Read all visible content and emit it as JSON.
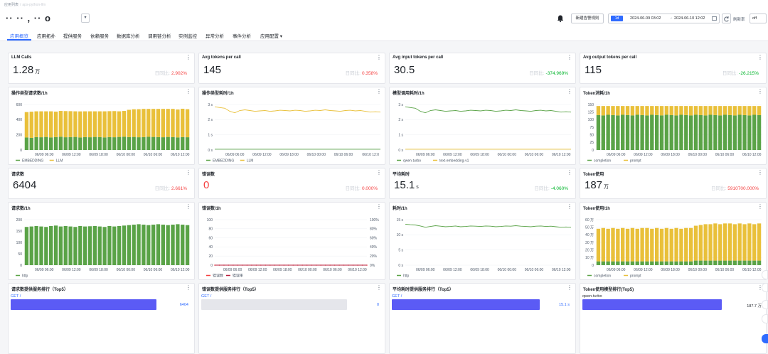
{
  "breadcrumb": {
    "root": "应用列表",
    "sep": "/",
    "current": "aps-python-llm"
  },
  "header": {
    "app_name": "·· ·· , ·· o",
    "new_alert_button": "新建告警规则",
    "time_chip": "1d",
    "time_start": "2024-06-09 03:02",
    "time_arrow": "→",
    "time_end": "2024-06-10 12:02",
    "refresh_label": "刷新率",
    "refresh_value": "off"
  },
  "tabs": [
    {
      "label": "应用概览",
      "active": true
    },
    {
      "label": "应用拓扑"
    },
    {
      "label": "提供服务"
    },
    {
      "label": "依赖服务"
    },
    {
      "label": "数据库分析"
    },
    {
      "label": "调用链分析"
    },
    {
      "label": "实例监控"
    },
    {
      "label": "异常分析"
    },
    {
      "label": "事件分析"
    },
    {
      "label": "应用配置 ▾"
    }
  ],
  "kpis": [
    {
      "title": "LLM Calls",
      "value": "1.28",
      "unit": "万",
      "cmp_label": "日同比:",
      "cmp_value": "2.902%",
      "tone": "red"
    },
    {
      "title": "Avg tokens per call",
      "value": "145",
      "unit": "",
      "cmp_label": "日同比:",
      "cmp_value": "0.358%",
      "tone": "red"
    },
    {
      "title": "Avg input tokens per call",
      "value": "30.5",
      "unit": "",
      "cmp_label": "日同比:",
      "cmp_value": "-374.969%",
      "tone": "green"
    },
    {
      "title": "Avg output tokens per call",
      "value": "115",
      "unit": "",
      "cmp_label": "日同比:",
      "cmp_value": "-26.215%",
      "tone": "green"
    },
    {
      "title": "请求数",
      "value": "6404",
      "unit": "",
      "cmp_label": "日同比:",
      "cmp_value": "2.661%",
      "tone": "red"
    },
    {
      "title": "错误数",
      "value": "0",
      "unit": "",
      "cmp_label": "日同比:",
      "cmp_value": "0.000%",
      "tone": "red",
      "value_red": true
    },
    {
      "title": "平均耗时",
      "value": "15.1",
      "unit": "s",
      "cmp_label": "日同比:",
      "cmp_value": "-4.060%",
      "tone": "green"
    },
    {
      "title": "Token使用",
      "value": "187",
      "unit": "万",
      "cmp_label": "日同比:",
      "cmp_value": "5910700.000%",
      "tone": "red"
    }
  ],
  "chart_titles": [
    "操作类型请求数/1h",
    "操作类型耗时/1h",
    "模型调用耗时/1h",
    "Token消耗/1h",
    "请求数/1h",
    "错误数/1h",
    "耗时/1h",
    "Token使用/1h"
  ],
  "menu_icon": "⋮",
  "chart_data": [
    {
      "type": "bar",
      "title": "操作类型请求数/1h",
      "x_ticks": [
        "06/09 06:00",
        "06/09 12:00",
        "06/09 18:00",
        "06/10 00:00",
        "06/10 06:00",
        "06/10 12:00"
      ],
      "y_ticks": [
        "0",
        "200",
        "400",
        "600"
      ],
      "ylim": [
        0,
        600
      ],
      "stacked": true,
      "categories_count": 34,
      "series": [
        {
          "name": "EMBEDDING",
          "color": "#5aa347",
          "values": [
            165,
            160,
            170,
            168,
            172,
            166,
            170,
            175,
            168,
            170,
            172,
            165,
            170,
            168,
            172,
            170,
            166,
            170,
            168,
            172,
            175,
            170,
            172,
            168,
            170,
            174,
            172,
            170,
            168,
            172,
            170,
            166,
            170,
            168
          ]
        },
        {
          "name": "LLM",
          "color": "#e9c03a",
          "values": [
            335,
            345,
            340,
            342,
            338,
            344,
            336,
            340,
            345,
            342,
            338,
            344,
            340,
            342,
            338,
            340,
            344,
            342,
            345,
            338,
            340,
            360,
            365,
            370,
            372,
            368,
            370,
            372,
            374,
            370,
            372,
            368,
            374,
            370
          ]
        }
      ],
      "legend": "bottom-left"
    },
    {
      "type": "line",
      "title": "操作类型耗时/1h",
      "x_ticks": [
        "06/09 06:00",
        "06/09 12:00",
        "06/09 18:00",
        "06/10 00:00",
        "06/10 06:00",
        "06/10 12:0"
      ],
      "y_ticks": [
        "0 s",
        "1 s",
        "2 s",
        "3 s"
      ],
      "ylim": [
        0,
        3
      ],
      "series": [
        {
          "name": "EMBEDDING",
          "color": "#5aa347",
          "values": [
            0.05,
            0.05,
            0.05,
            0.05,
            0.05,
            0.05,
            0.05,
            0.05,
            0.05,
            0.05,
            0.05,
            0.05,
            0.05,
            0.05,
            0.05,
            0.05,
            0.05,
            0.05,
            0.05,
            0.05,
            0.05,
            0.05,
            0.05,
            0.05,
            0.05,
            0.05,
            0.05,
            0.05,
            0.05,
            0.05,
            0.05,
            0.05,
            0.05,
            0.05
          ]
        },
        {
          "name": "LLM",
          "color": "#e9c03a",
          "values": [
            2.85,
            2.8,
            2.75,
            2.55,
            2.45,
            2.6,
            2.65,
            2.6,
            2.55,
            2.58,
            2.6,
            2.55,
            2.58,
            2.62,
            2.6,
            2.58,
            2.62,
            2.6,
            2.55,
            2.58,
            2.62,
            2.6,
            2.65,
            2.6,
            2.58,
            2.55,
            2.6,
            2.62,
            2.58,
            2.6,
            2.55,
            2.5,
            2.52,
            2.5
          ]
        }
      ],
      "legend": "bottom-left"
    },
    {
      "type": "line",
      "title": "模型调用耗时/1h",
      "x_ticks": [
        "06/09 06:00",
        "06/09 12:00",
        "06/09 18:00",
        "06/10 00:00",
        "06/10 06:00",
        "06/10 12:00"
      ],
      "y_ticks": [
        "0 s",
        "1 s",
        "2 s",
        "3 s"
      ],
      "ylim": [
        0,
        3
      ],
      "series": [
        {
          "name": "qwen-turbo",
          "color": "#5aa347",
          "values": [
            2.85,
            2.8,
            2.75,
            2.55,
            2.45,
            2.6,
            2.65,
            2.6,
            2.55,
            2.58,
            2.6,
            2.55,
            2.58,
            2.62,
            2.6,
            2.58,
            2.62,
            2.6,
            2.55,
            2.58,
            2.62,
            2.6,
            2.65,
            2.6,
            2.58,
            2.55,
            2.6,
            2.62,
            2.58,
            2.6,
            2.55,
            2.5,
            2.52,
            2.5
          ]
        },
        {
          "name": "text-embedding-v1",
          "color": "#e9c03a",
          "values": [
            0.05,
            0.05,
            0.05,
            0.05,
            0.05,
            0.05,
            0.05,
            0.05,
            0.05,
            0.05,
            0.05,
            0.05,
            0.05,
            0.05,
            0.05,
            0.05,
            0.05,
            0.05,
            0.05,
            0.05,
            0.05,
            0.05,
            0.05,
            0.05,
            0.05,
            0.05,
            0.05,
            0.05,
            0.05,
            0.05,
            0.05,
            0.05,
            0.05,
            0.05
          ]
        }
      ],
      "legend": "bottom-left"
    },
    {
      "type": "bar",
      "title": "Token消耗/1h",
      "x_ticks": [
        "06/09 06:00",
        "06/09 12:00",
        "06/09 18:00",
        "06/10 00:00",
        "06/10 06:00",
        "06/10 12:00"
      ],
      "y_ticks": [
        "0",
        "25",
        "50",
        "75",
        "100",
        "125",
        "150"
      ],
      "ylim": [
        0,
        150
      ],
      "stacked": true,
      "categories_count": 34,
      "series": [
        {
          "name": "completion",
          "color": "#5aa347",
          "values": [
            115,
            114,
            116,
            115,
            114,
            116,
            115,
            114,
            116,
            115,
            114,
            116,
            115,
            114,
            116,
            115,
            114,
            116,
            115,
            114,
            116,
            115,
            114,
            116,
            115,
            114,
            116,
            115,
            114,
            116,
            115,
            114,
            116,
            115
          ]
        },
        {
          "name": "prompt",
          "color": "#e9c03a",
          "values": [
            30,
            31,
            29,
            30,
            31,
            29,
            30,
            31,
            29,
            30,
            31,
            29,
            30,
            31,
            29,
            30,
            31,
            29,
            30,
            31,
            29,
            30,
            31,
            29,
            30,
            31,
            29,
            30,
            31,
            29,
            30,
            31,
            29,
            30
          ]
        }
      ],
      "legend": "bottom-left"
    },
    {
      "type": "bar",
      "title": "请求数/1h",
      "x_ticks": [
        "06/09 06:00",
        "06/09 12:00",
        "06/09 18:00",
        "06/10 00:00",
        "06/10 06:00",
        "06/10 12:00"
      ],
      "y_ticks": [
        "0",
        "50",
        "100",
        "150",
        "200"
      ],
      "ylim": [
        0,
        200
      ],
      "categories_count": 34,
      "series": [
        {
          "name": "http",
          "color": "#5aa347",
          "values": [
            168,
            170,
            172,
            170,
            168,
            172,
            174,
            170,
            172,
            170,
            168,
            172,
            170,
            171,
            172,
            170,
            168,
            172,
            170,
            172,
            174,
            176,
            178,
            180,
            178,
            176,
            178,
            180,
            178,
            176,
            178,
            180,
            178,
            176
          ]
        }
      ],
      "legend": "bottom-left"
    },
    {
      "type": "line",
      "title": "错误数/1h",
      "x_ticks": [
        "06/09 06:00",
        "06/09 12:00",
        "06/09 18:00",
        "06/10 00:00",
        "06/10 06:00",
        "06/10 12:00"
      ],
      "y_ticks": [
        "0",
        "20",
        "40",
        "60",
        "80",
        "100"
      ],
      "y2_ticks": [
        "0%",
        "20%",
        "40%",
        "60%",
        "80%",
        "100%"
      ],
      "ylim": [
        0,
        100
      ],
      "series": [
        {
          "name": "错误数",
          "color": "#f53f3f",
          "dashed": true,
          "values": [
            0,
            0,
            0,
            0,
            0,
            0,
            0,
            0,
            0,
            0,
            0,
            0,
            0,
            0,
            0,
            0,
            0,
            0,
            0,
            0,
            0,
            0,
            0,
            0,
            0,
            0,
            0,
            0,
            0,
            0,
            0,
            0,
            0,
            0
          ]
        },
        {
          "name": "错误率",
          "color": "#b71c3a",
          "values": [
            0,
            0,
            0,
            0,
            0,
            0,
            0,
            0,
            0,
            0,
            0,
            0,
            0,
            0,
            0,
            0,
            0,
            0,
            0,
            0,
            0,
            0,
            0,
            0,
            0,
            0,
            0,
            0,
            0,
            0,
            0,
            0,
            0,
            0
          ]
        }
      ],
      "legend": "bottom-left"
    },
    {
      "type": "line",
      "title": "耗时/1h",
      "x_ticks": [
        "06/09 06:00",
        "06/09 12:00",
        "06/09 18:00",
        "06/10 00:00",
        "06/10 06:00",
        "06/10 12:00"
      ],
      "y_ticks": [
        "0 s",
        "5 s",
        "10 s",
        "15 s"
      ],
      "ylim": [
        0,
        18
      ],
      "series": [
        {
          "name": "http",
          "color": "#5aa347",
          "values": [
            16.2,
            16.0,
            15.9,
            15.5,
            15.0,
            15.3,
            15.6,
            15.4,
            15.2,
            15.3,
            15.5,
            15.2,
            15.3,
            15.5,
            15.4,
            15.3,
            15.5,
            15.4,
            15.2,
            15.3,
            15.5,
            15.4,
            15.6,
            15.4,
            15.3,
            15.2,
            15.4,
            15.5,
            15.3,
            15.4,
            15.2,
            15.0,
            15.1,
            15.0
          ]
        }
      ],
      "legend": "bottom-left"
    },
    {
      "type": "bar",
      "title": "Token使用/1h",
      "x_ticks": [
        "06/09 06:00",
        "06/09 12:00",
        "06/09 18:00",
        "06/10 00:00",
        "06/10 06:00",
        "06/10 12:00"
      ],
      "y_ticks": [
        "0",
        "10 万",
        "20 万",
        "30 万",
        "40 万",
        "50 万",
        "60 万"
      ],
      "ylim": [
        0,
        60
      ],
      "stacked": true,
      "categories_count": 34,
      "series": [
        {
          "name": "completion",
          "color": "#5aa347",
          "values": [
            5,
            5,
            5,
            5,
            5,
            5,
            5,
            5,
            5,
            5,
            5,
            5,
            5,
            5,
            5,
            5,
            5,
            5,
            5,
            5,
            6,
            6,
            6,
            6,
            6,
            6,
            6,
            6,
            6,
            6,
            6,
            6,
            6,
            6
          ]
        },
        {
          "name": "prompt",
          "color": "#e9c03a",
          "values": [
            43,
            44,
            43,
            44,
            43,
            44,
            43,
            44,
            43,
            44,
            44,
            43,
            44,
            43,
            44,
            43,
            44,
            43,
            44,
            44,
            46,
            47,
            48,
            48,
            49,
            48,
            49,
            49,
            48,
            49,
            48,
            49,
            48,
            49
          ]
        }
      ],
      "legend": "bottom-left"
    }
  ],
  "rankings": [
    {
      "title": "请求数提供服务排行（Top5）",
      "label": "GET /",
      "value": "6404",
      "fraction": 1.0,
      "fill": "#5b5bf5"
    },
    {
      "title": "错误数提供服务排行（Top5）",
      "label": "GET /",
      "value": "0",
      "fraction": 0.0,
      "fill": "#e5e6eb"
    },
    {
      "title": "平均耗时提供服务排行（Top5）",
      "label": "GET /",
      "value": "15.1 s",
      "fraction": 1.0,
      "fill": "#5b5bf5"
    },
    {
      "title": "Token使用模型排行(Top5)",
      "label": "qwen-turbo",
      "value": "187.7 万",
      "fraction": 1.0,
      "fill": "#5b5bf5",
      "dark": true
    }
  ]
}
